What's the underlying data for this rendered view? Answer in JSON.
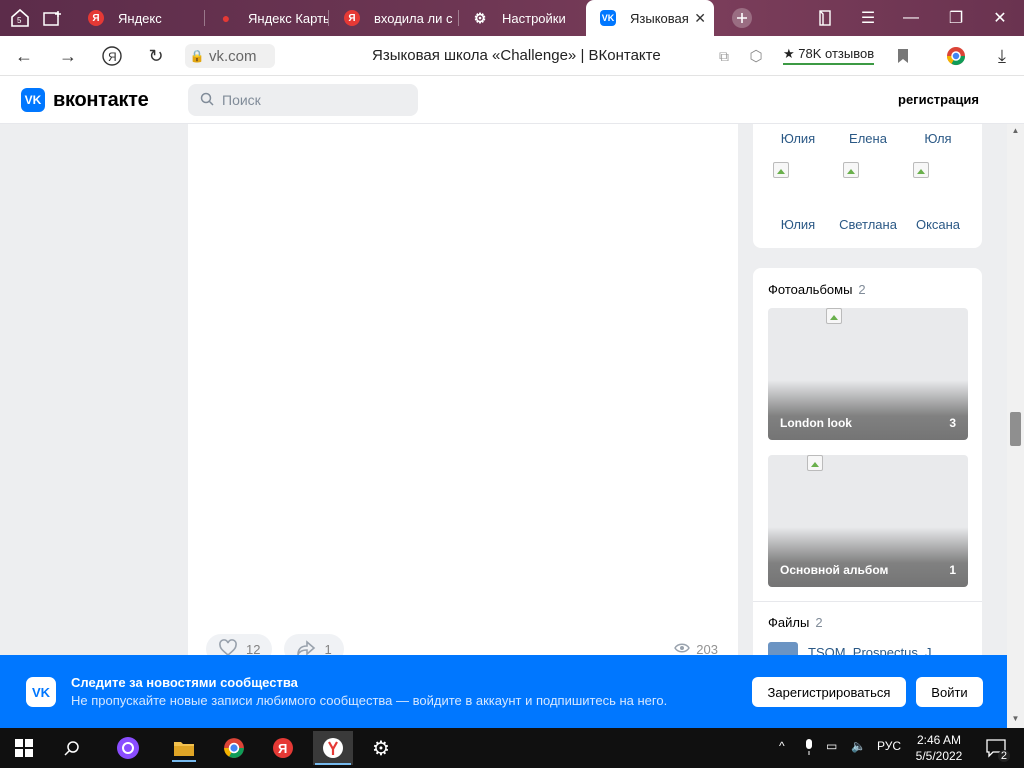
{
  "browser": {
    "tabs": [
      {
        "label": "Яндекс",
        "favicon": "yandex-icon",
        "color": "#e53935"
      },
      {
        "label": "Яндекс Карты",
        "favicon": "maps-pin-icon",
        "color": "#e53935"
      },
      {
        "label": "входила ли с",
        "favicon": "yandex-icon",
        "color": "#e53935"
      },
      {
        "label": "Настройки",
        "favicon": "gear-icon",
        "color": "#ffffff"
      },
      {
        "label": "Языковая ш",
        "favicon": "vk-icon",
        "color": "#0077ff"
      }
    ],
    "url": "vk.com",
    "page_title": "Языковая школа «Challenge» | ВКонтакте",
    "reviews": "★ 78K отзывов",
    "tabs_counter": "3",
    "downloads_badge": "1"
  },
  "vk": {
    "logo_text": "вконтакте",
    "search_placeholder": "Поиск",
    "register_link": "регистрация"
  },
  "post": {
    "likes": "12",
    "shares": "1",
    "views": "203"
  },
  "members": [
    {
      "name": "Юлия"
    },
    {
      "name": "Елена"
    },
    {
      "name": "Юля"
    },
    {
      "name": "Юлия"
    },
    {
      "name": "Светлана"
    },
    {
      "name": "Оксана"
    }
  ],
  "albums_block": {
    "title": "Фотоальбомы",
    "count": "2",
    "albums": [
      {
        "name": "London look",
        "count": "3"
      },
      {
        "name": "Основной альбом",
        "count": "1"
      }
    ]
  },
  "files_block": {
    "title": "Файлы",
    "count": "2",
    "first_file": "TSOM_Prospectus_J.."
  },
  "banner": {
    "title": "Следите за новостями сообщества",
    "text": "Не пропускайте новые записи любимого сообщества — войдите в аккаунт и подпишитесь на него.",
    "register_button": "Зарегистрироваться",
    "login_button": "Войти"
  },
  "taskbar": {
    "language": "РУС",
    "time": "2:46 AM",
    "date": "5/5/2022",
    "notifications": "2"
  }
}
